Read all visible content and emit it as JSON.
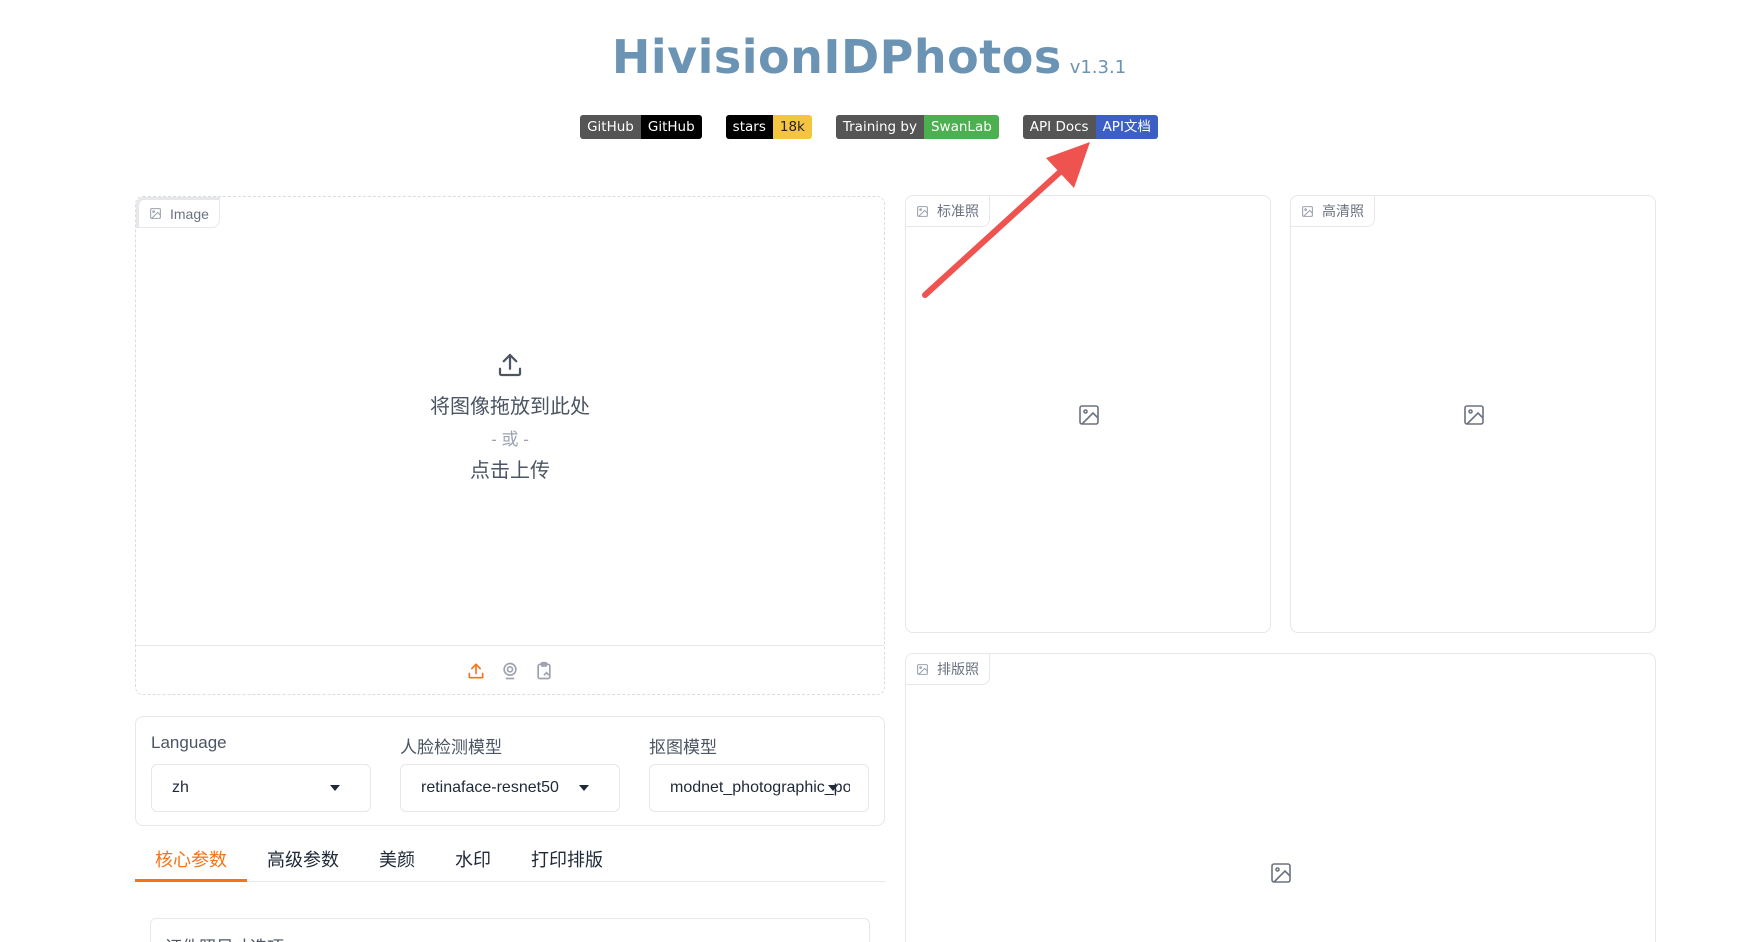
{
  "header": {
    "title": "HivisionIDPhotos",
    "version": "v1.3.1"
  },
  "badges": [
    {
      "left": "GitHub",
      "right": "GitHub",
      "left_color": "#555555",
      "right_color": "#000000"
    },
    {
      "left": "stars",
      "right": "18k",
      "left_color": "#000000",
      "right_color": "#f5c542"
    },
    {
      "left": "Training by",
      "right": "SwanLab",
      "left_color": "#555555",
      "right_color": "#4caf50"
    },
    {
      "left": "API Docs",
      "right": "API文档",
      "left_color": "#555555",
      "right_color": "#3b5fc4"
    }
  ],
  "image_input": {
    "label": "Image",
    "drop_text": "将图像拖放到此处",
    "or_text": "- 或 -",
    "click_text": "点击上传"
  },
  "outputs": {
    "standard_label": "标准照",
    "hd_label": "高清照",
    "layout_label": "排版照"
  },
  "options": {
    "language": {
      "label": "Language",
      "value": "zh"
    },
    "face_model": {
      "label": "人脸检测模型",
      "value": "retinaface-resnet50"
    },
    "matting_model": {
      "label": "抠图模型",
      "value": "modnet_photographic_portrait_matting"
    }
  },
  "tabs": [
    "核心参数",
    "高级参数",
    "美颜",
    "水印",
    "打印排版"
  ],
  "active_tab": "核心参数",
  "core_params": {
    "size_label": "证件照尺寸选项"
  },
  "colors": {
    "title": "#6b93b3",
    "accent": "#f97316",
    "annotation_arrow": "#ef5350"
  }
}
